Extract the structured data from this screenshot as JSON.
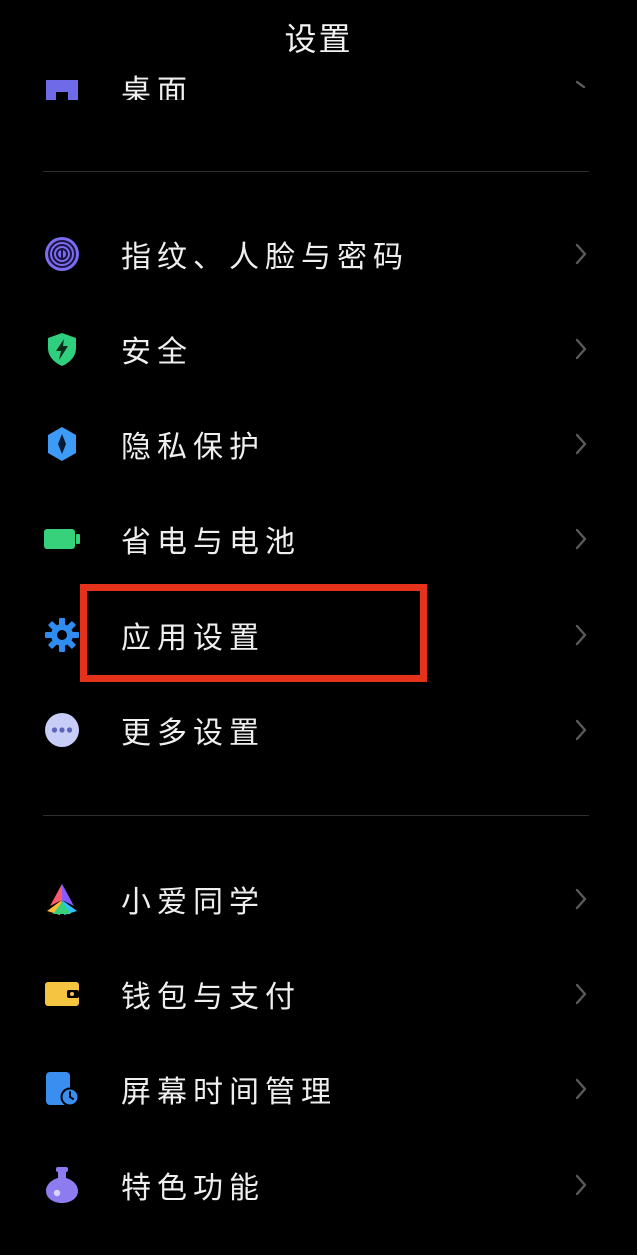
{
  "header": {
    "title": "设置"
  },
  "partial_item": {
    "label": "桌面"
  },
  "group1": [
    {
      "id": "fingerprint",
      "label": "指纹、人脸与密码",
      "icon": "fingerprint-icon"
    },
    {
      "id": "security",
      "label": "安全",
      "icon": "shield-bolt-icon"
    },
    {
      "id": "privacy",
      "label": "隐私保护",
      "icon": "privacy-shield-icon"
    },
    {
      "id": "battery",
      "label": "省电与电池",
      "icon": "battery-icon"
    },
    {
      "id": "app-settings",
      "label": "应用设置",
      "icon": "gear-icon"
    },
    {
      "id": "more-settings",
      "label": "更多设置",
      "icon": "more-dots-icon"
    }
  ],
  "group2": [
    {
      "id": "xiaoai",
      "label": "小爱同学",
      "icon": "xiaoai-icon"
    },
    {
      "id": "wallet",
      "label": "钱包与支付",
      "icon": "wallet-icon"
    },
    {
      "id": "screen-time",
      "label": "屏幕时间管理",
      "icon": "screen-time-icon"
    },
    {
      "id": "special-features",
      "label": "特色功能",
      "icon": "flask-icon"
    }
  ],
  "colors": {
    "background": "#000000",
    "text": "#efefef",
    "chevron": "#5a5a5a",
    "divider": "#2e2e2e",
    "highlight_box": "#e4321b",
    "fingerprint": "#7b6cf0",
    "security": "#2fcf7f",
    "privacy": "#3d9bf5",
    "battery": "#36d17a",
    "gear": "#2f8cf0",
    "more": "#c7cdf7",
    "wallet": "#f5c542",
    "screen_time": "#3a8ef0",
    "flask": "#8c7cf0"
  }
}
